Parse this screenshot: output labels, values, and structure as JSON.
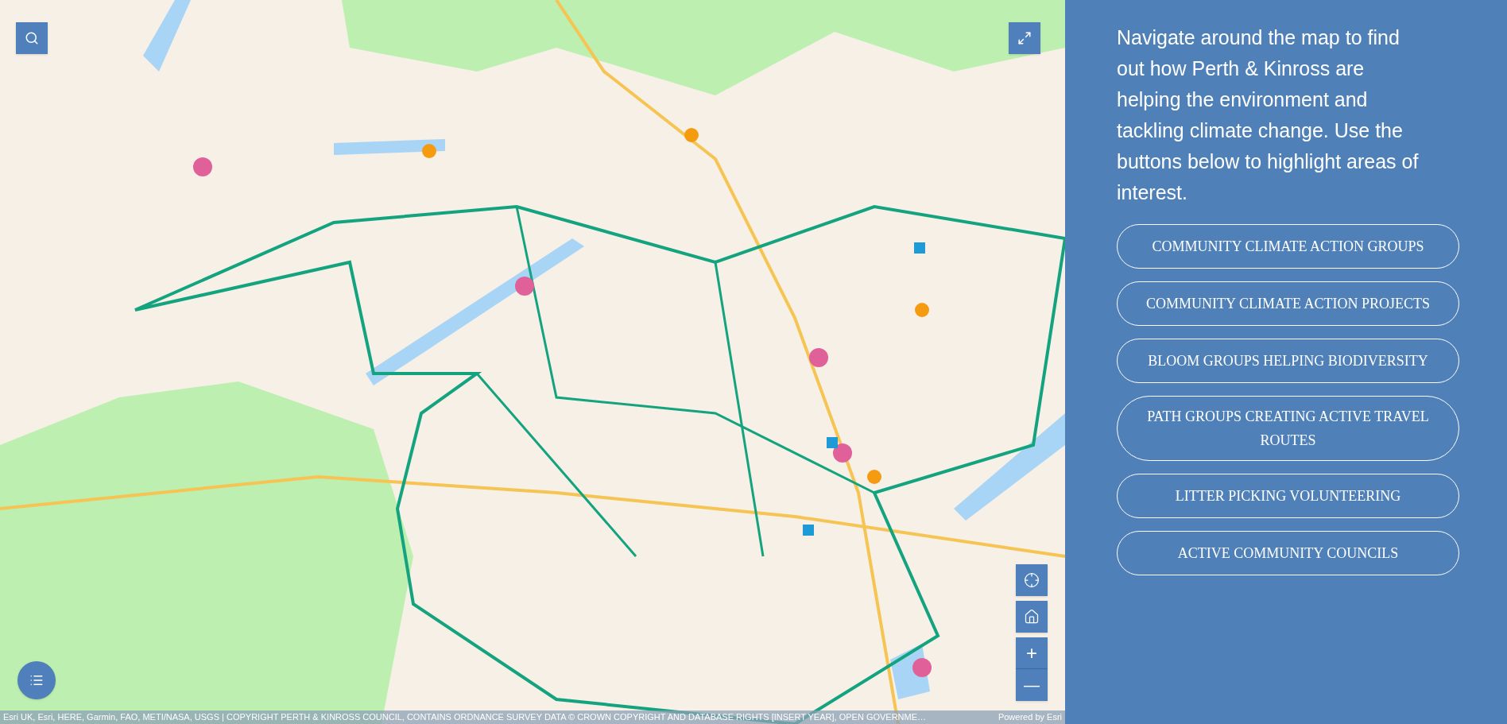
{
  "map": {
    "kind": "picture",
    "attribution": "Esri UK, Esri, HERE, Garmin, FAO, METI/NASA, USGS | COPYRIGHT PERTH & KINROSS COUNCIL, CONTAINS ORDNANCE SURVEY DATA © CROWN COPYRIGHT AND DATABASE RIGHTS [INSERT YEAR], OPEN GOVERNME…",
    "powered_by": "Powered by Esri",
    "zoom_in": "+",
    "zoom_out": "—"
  },
  "panel": {
    "intro": "Navigate around the map to find out how Perth & Kinross are helping the environment and tackling climate change. Use the buttons below to highlight areas of interest.",
    "buttons": [
      {
        "label": "COMMUNITY CLIMATE ACTION GROUPS"
      },
      {
        "label": "COMMUNITY CLIMATE ACTION PROJECTS"
      },
      {
        "label": "BLOOM GROUPS HELPING BIODIVERSITY"
      },
      {
        "label": "PATH GROUPS CREATING ACTIVE TRAVEL ROUTES"
      },
      {
        "label": "LITTER PICKING VOLUNTEERING"
      },
      {
        "label": "ACTIVE COMMUNITY COUNCILS"
      }
    ]
  }
}
